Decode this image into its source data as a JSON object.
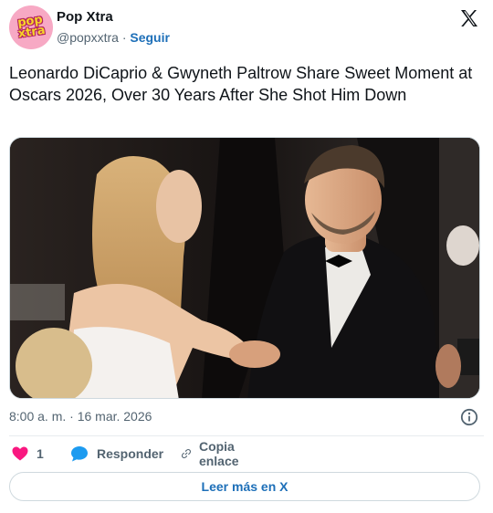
{
  "header": {
    "name": "Pop Xtra",
    "handle": "@popxxtra",
    "separator": "·",
    "follow_label": "Seguir",
    "avatar_text_1": "pop",
    "avatar_text_2": "xtra",
    "logo_icon": "x-logo-icon"
  },
  "tweet": {
    "text": "Leonardo DiCaprio & Gwyneth Paltrow Share Sweet Moment at Oscars 2026, Over 30 Years After She Shot Him Down",
    "timestamp": "8:00 a. m. · 16 mar. 2026"
  },
  "actions": {
    "like_count": "1",
    "reply_label": "Responder",
    "copy_label": "Copia enlace",
    "read_more_label": "Leer más en X"
  },
  "colors": {
    "accent": "#1d6fb8",
    "heart": "#f91880",
    "reply_bubble": "#1d9bf0",
    "muted": "#536471"
  }
}
